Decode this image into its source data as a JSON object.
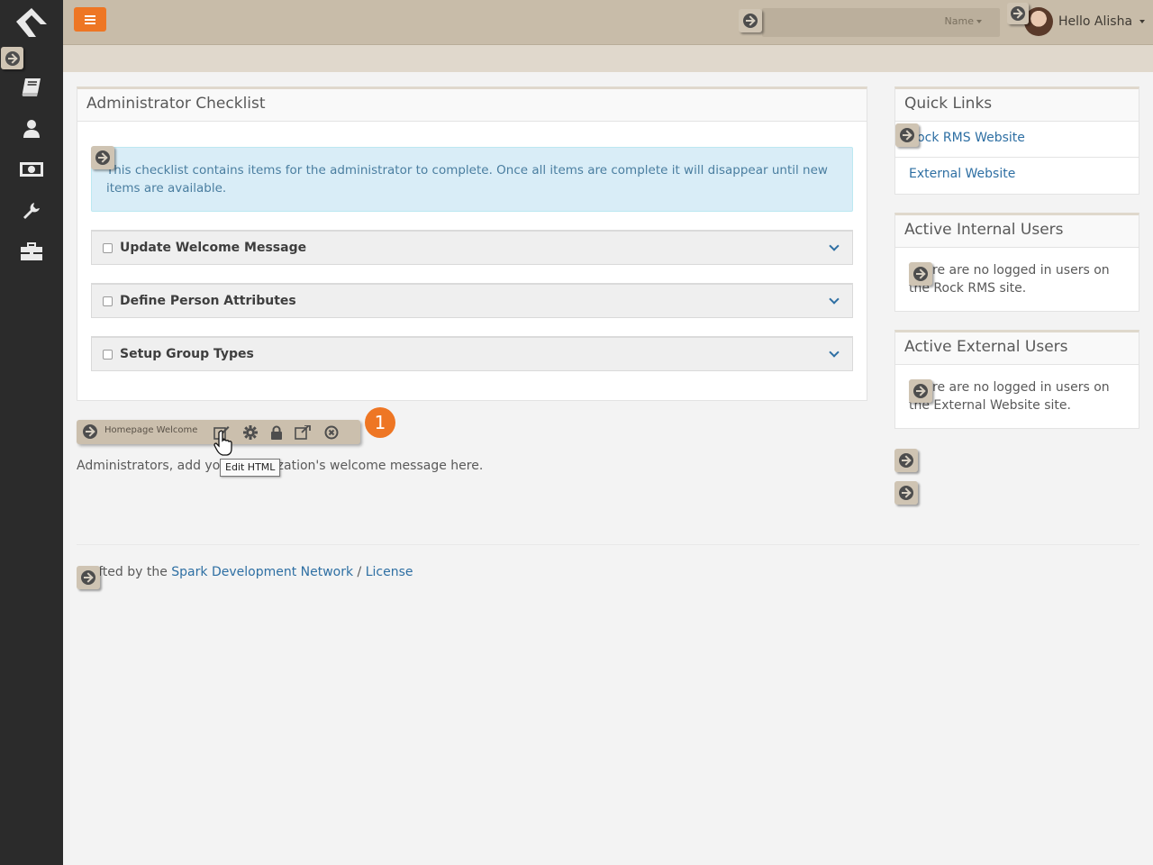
{
  "header": {
    "search_placeholder": "Name",
    "user_greeting": "Hello Alisha"
  },
  "sidebar": {
    "icons": [
      "book-icon",
      "person-icon",
      "money-icon",
      "wrench-icon",
      "briefcase-icon"
    ]
  },
  "checklist": {
    "title": "Administrator Checklist",
    "alert_text": "This checklist contains items for the administrator to complete. Once all items are complete it will disappear until new items are available.",
    "items": [
      {
        "label": "Update Welcome Message"
      },
      {
        "label": "Define Person Attributes"
      },
      {
        "label": "Setup Group Types"
      }
    ]
  },
  "quick_links": {
    "title": "Quick Links",
    "links": [
      "Rock RMS Website",
      "External Website"
    ]
  },
  "active_internal": {
    "title": "Active Internal Users",
    "text": "There are no logged in users on the Rock RMS site."
  },
  "active_external": {
    "title": "Active External Users",
    "text": "There are no logged in users on the External Website site."
  },
  "block_toolbar": {
    "title": "Homepage Welcome",
    "badge": "1",
    "tooltip": "Edit HTML"
  },
  "welcome_text": "Administrators, add your organization's welcome message here.",
  "footer": {
    "prefix": "Crafted by the ",
    "link1": "Spark Development Network",
    "separator": " / ",
    "link2": "License"
  },
  "colors": {
    "accent": "#ee7624",
    "header_bg": "#c8bca9",
    "sidebar_bg": "#2b2b2b",
    "link": "#2e6fa3"
  }
}
